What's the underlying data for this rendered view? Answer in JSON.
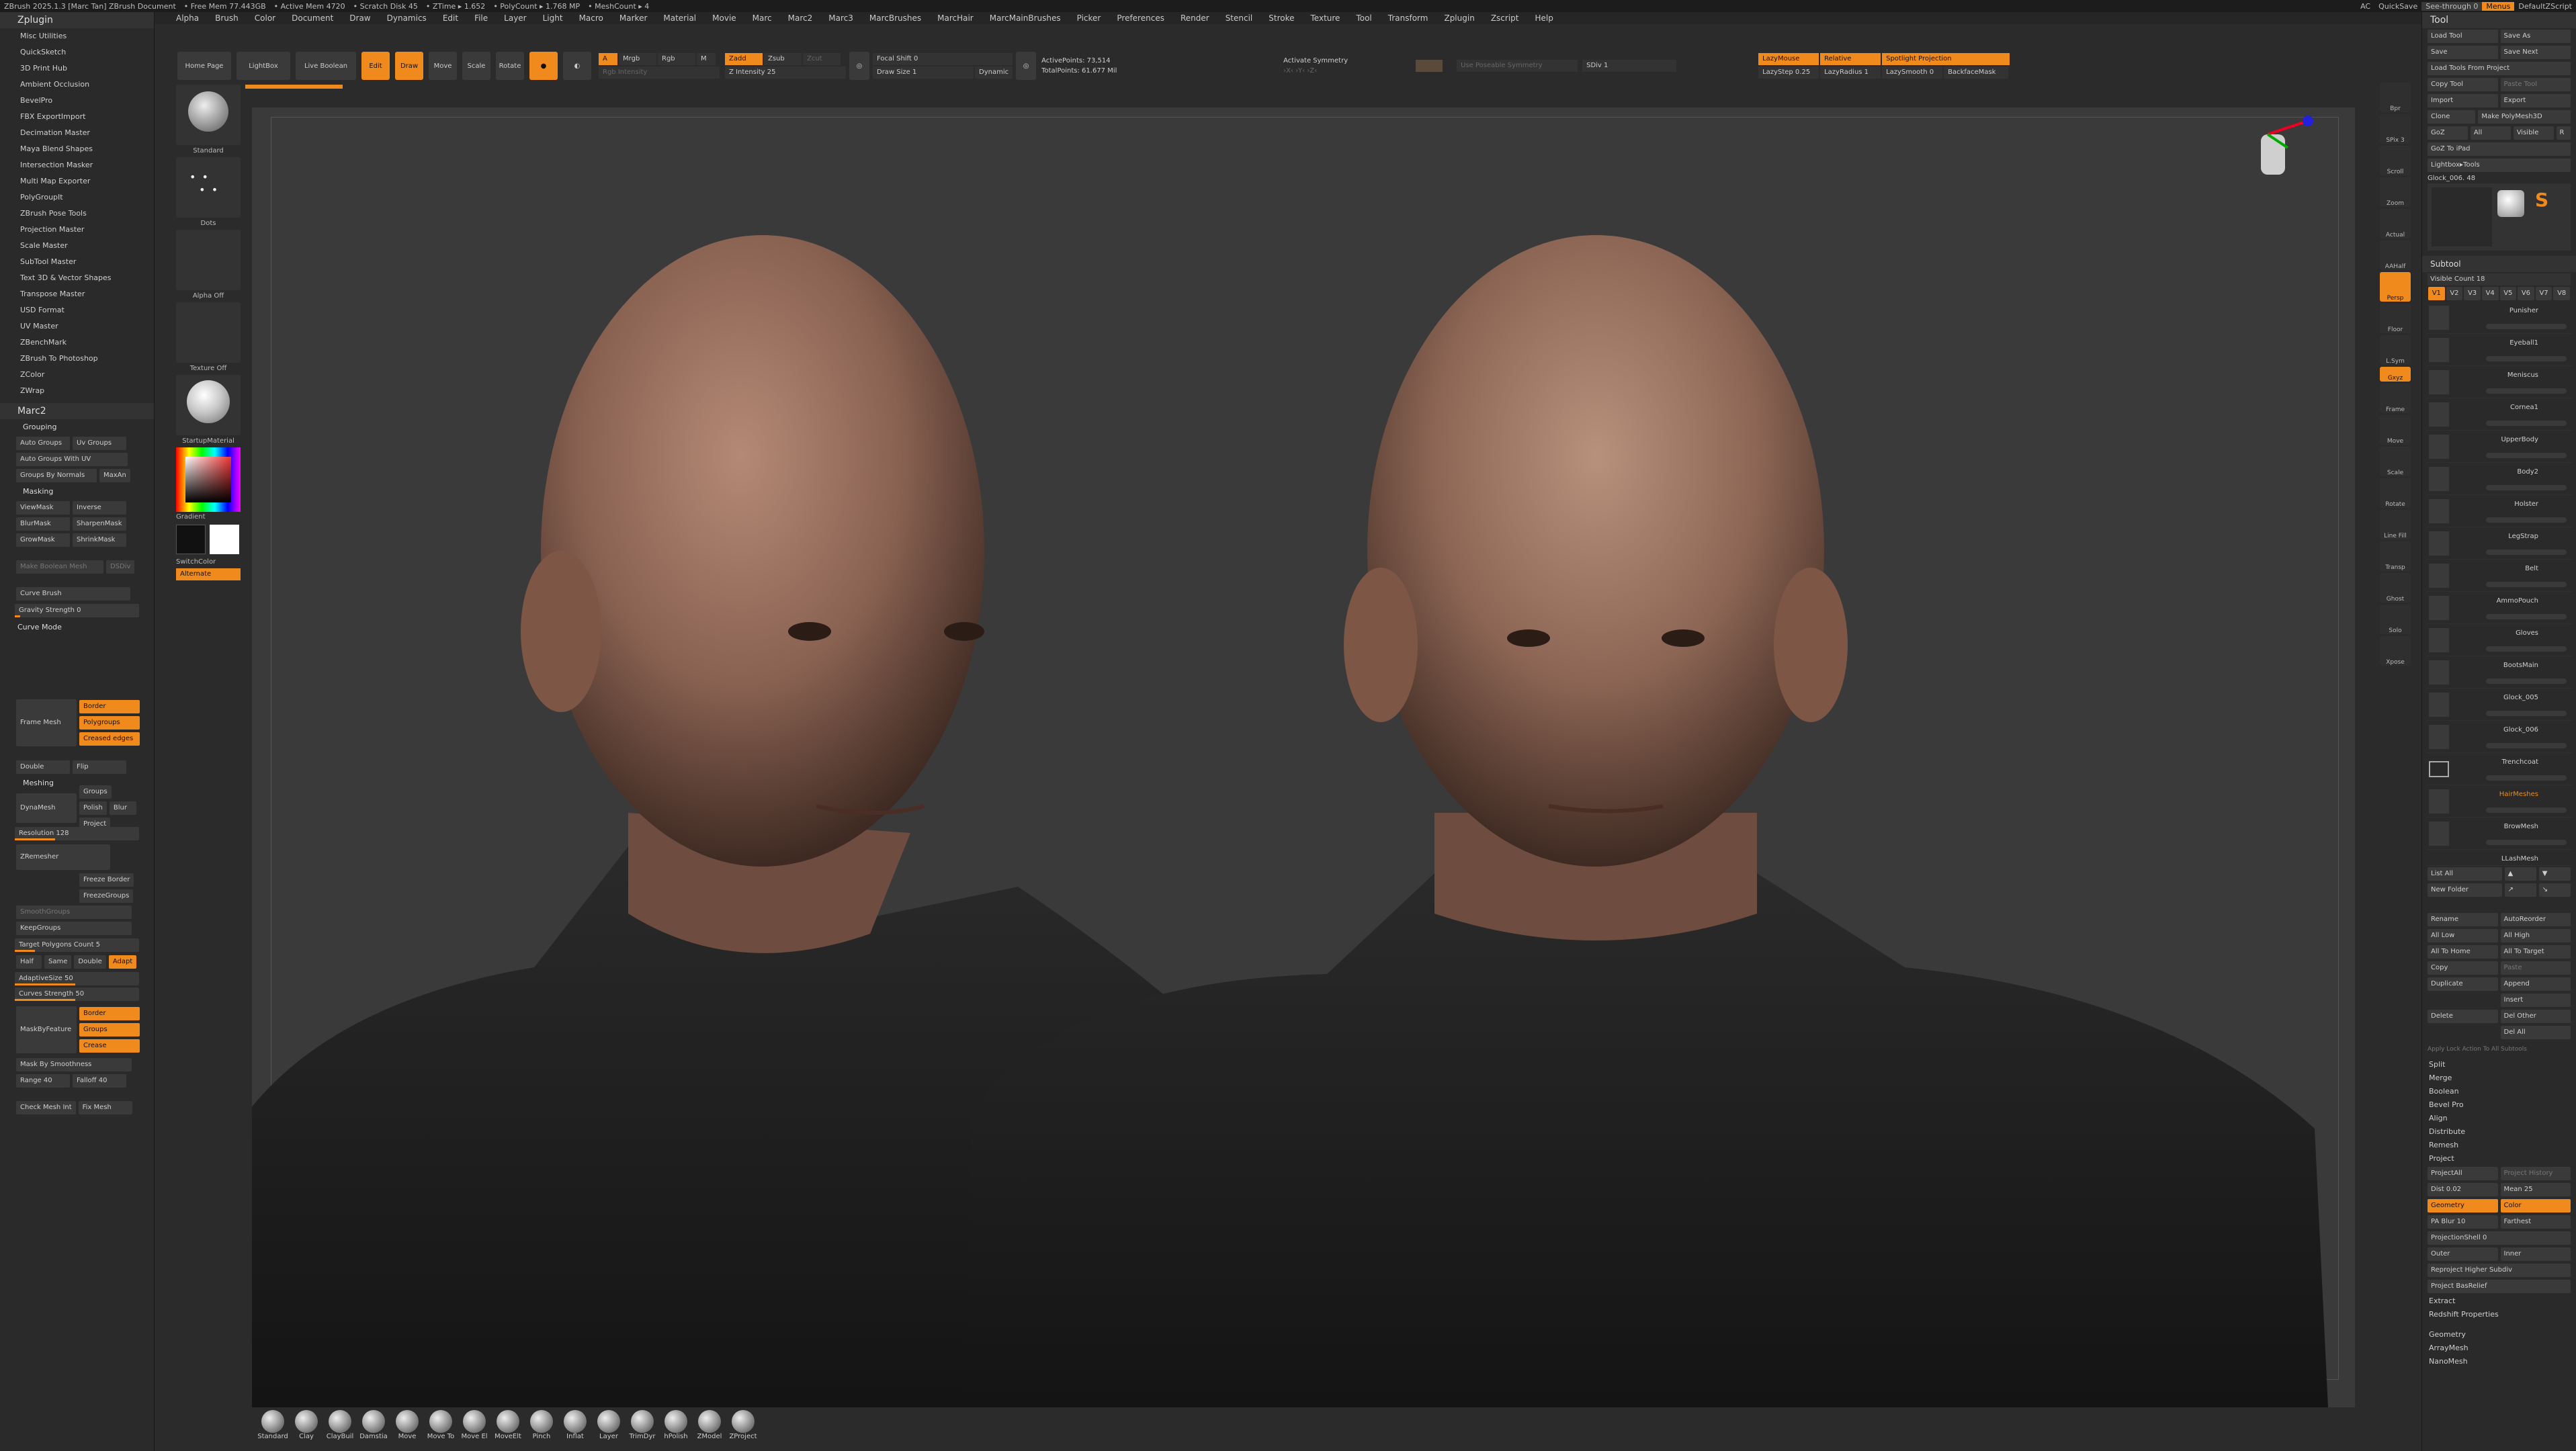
{
  "app": {
    "title": "ZBrush 2025.1.3 [Marc Tan]   ZBrush Document",
    "stats": [
      "• Free Mem 77.443GB",
      "• Active Mem 4720",
      "• Scratch Disk 45",
      "• ZTime ▸ 1.652",
      "• PolyCount ▸ 1.768 MP",
      "• MeshCount ▸ 4"
    ],
    "right_status": [
      "AC",
      "QuickSave",
      "See-through 0",
      "Menus",
      "DefaultZScript"
    ]
  },
  "menu": [
    "Alpha",
    "Brush",
    "Color",
    "Document",
    "Draw",
    "Dynamics",
    "Edit",
    "File",
    "Layer",
    "Light",
    "Macro",
    "Marker",
    "Material",
    "Movie",
    "Marc",
    "Marc2",
    "Marc3",
    "MarcBrushes",
    "MarcHair",
    "MarcMainBrushes",
    "Picker",
    "Preferences",
    "Render",
    "Stencil",
    "Stroke",
    "Texture",
    "Tool",
    "Transform",
    "Zplugin",
    "Zscript",
    "Help"
  ],
  "left_panel": {
    "title": "Zplugin",
    "plugins": [
      "Misc Utilities",
      "QuickSketch",
      "3D Print Hub",
      "Ambient Occlusion",
      "BevelPro",
      "FBX ExportImport",
      "Decimation Master",
      "Maya Blend Shapes",
      "Intersection Masker",
      "Multi Map Exporter",
      "PolyGroupIt",
      "ZBrush Pose Tools",
      "Projection Master",
      "Scale Master",
      "SubTool Master",
      "Text 3D & Vector Shapes",
      "Transpose Master",
      "USD Format",
      "UV Master",
      "ZBenchMark",
      "ZBrush To Photoshop",
      "ZColor",
      "ZWrap"
    ],
    "sub_title": "Marc2",
    "grouping_label": "Grouping",
    "grouping": [
      [
        "Auto Groups",
        "Uv Groups"
      ],
      [
        "Auto Groups With UV",
        ""
      ],
      [
        "Groups By Normals",
        "MaxAn"
      ]
    ],
    "masking_label": "Masking",
    "masking": [
      [
        "ViewMask",
        "Inverse"
      ],
      [
        "BlurMask",
        "SharpenMask"
      ],
      [
        "GrowMask",
        "ShrinkMask"
      ]
    ],
    "make_boolean": "Make Boolean Mesh",
    "dsdiv": "DSDiv",
    "curve_brush": "Curve Brush",
    "gravity": "Gravity Strength 0",
    "curve_mode": "Curve Mode",
    "frame_mesh": "Frame Mesh",
    "frame_opts": [
      "Border",
      "Polygroups",
      "Creased edges"
    ],
    "double": "Double",
    "flip": "Flip",
    "meshing": "Meshing",
    "dynamesh": "DynaMesh",
    "dyn_opts": [
      "Groups",
      "Polish",
      "Blur",
      "Project"
    ],
    "resolution": "Resolution 128",
    "zremesher": "ZRemesher",
    "freeze_border": "Freeze Border",
    "freeze_groups": "FreezeGroups",
    "smooth_groups": "SmoothGroups",
    "keep_groups": "KeepGroups",
    "target_poly": "Target Polygons Count 5",
    "half_row": [
      "Half",
      "Same",
      "Double",
      "Adapt"
    ],
    "adaptive": "AdaptiveSize 50",
    "curves_strength": "Curves Strength 50",
    "mask_by_feature": "MaskByFeature",
    "mbf_opts": [
      "Border",
      "Groups",
      "Crease"
    ],
    "mask_smooth": "Mask By Smoothness",
    "range": "Range 40",
    "falloff": "Falloff 40",
    "check_mesh": "Check Mesh Int",
    "fix_mesh": "Fix Mesh"
  },
  "shelf": {
    "brush_label": "Standard",
    "stroke_label": "Dots",
    "alpha_label": "Alpha Off",
    "texture_label": "Texture Off",
    "material_label": "StartupMaterial",
    "gradient_label": "Gradient",
    "switch_label": "SwitchColor",
    "alternate_label": "Alternate"
  },
  "top_tools": {
    "tabs": [
      "Home Page",
      "LightBox",
      "Live Boolean"
    ],
    "buttons": [
      "Edit",
      "Draw",
      "Move",
      "Scale",
      "Rotate"
    ],
    "mrgb": [
      "A",
      "Mrgb",
      "Rgb",
      "M"
    ],
    "zadd": "Zadd",
    "zsub": "Zsub",
    "zcut": "Zcut",
    "rgb_intensity": "Rgb Intensity",
    "z_intensity": "Z Intensity 25",
    "focal_shift": "Focal Shift 0",
    "draw_size": "Draw Size 1",
    "dynamic": "Dynamic",
    "active_points": "ActivePoints: 73,514",
    "total_points": "TotalPoints: 61.677 Mil",
    "symmetry": "Activate Symmetry",
    "use_poseable": "Use Poseable Symmetry",
    "sdiv": "SDiv 1",
    "lazymouse": "LazyMouse",
    "relative": "Relative",
    "spotlight": "Spotlight Projection",
    "lazystep": "LazyStep 0.25",
    "lazyradius": "LazyRadius 1",
    "lazysmooth": "LazySmooth 0",
    "backface": "BackfaceMask"
  },
  "right_dock": [
    "Bpr",
    "SPix 3",
    "Scroll",
    "Zoom",
    "Actual",
    "AAHalf",
    "Persp",
    "Floor",
    "L.Sym",
    "Move",
    "Frame",
    "Move",
    "Scale",
    "Rotate",
    "Line Fill",
    "Transp",
    "Ghost",
    "Solo",
    "Xpose"
  ],
  "right_panel": {
    "title": "Tool",
    "rows": [
      [
        "Load Tool",
        "Save As"
      ],
      [
        "Save",
        "Save Next"
      ],
      [
        "Load Tools From Project",
        ""
      ],
      [
        "Copy Tool",
        "Paste Tool"
      ],
      [
        "Import",
        "Export"
      ],
      [
        "Clone",
        "Make PolyMesh3D"
      ],
      [
        "GoZ",
        "All",
        "Visible",
        "R"
      ],
      [
        "GoZ To iPad",
        ""
      ],
      [
        "Lightbox▸Tools",
        ""
      ]
    ],
    "current_tool": "Glock_006. 48",
    "subtool_title": "Subtool",
    "visible_count": "Visible Count 18",
    "versions": [
      "V1",
      "V2",
      "V3",
      "V4",
      "V5",
      "V6",
      "V7",
      "V8"
    ],
    "subtools": [
      "Punisher",
      "Eyeball1",
      "Meniscus",
      "Cornea1",
      "UpperBody",
      "Body2",
      "Holster",
      "LegStrap",
      "Belt",
      "AmmoPouch",
      "Gloves",
      "BootsMain",
      "Glock_005",
      "Glock_006",
      "Trenchcoat",
      "HairMeshes",
      "BrowMesh",
      "LLashMesh"
    ],
    "list_all": "List All",
    "new_folder": "New Folder",
    "actions": [
      [
        "Rename",
        "AutoReorder"
      ],
      [
        "All Low",
        "All High"
      ],
      [
        "All To Home",
        "All To Target"
      ],
      [
        "Copy",
        "Paste"
      ],
      [
        "Duplicate",
        "Append"
      ],
      [
        "",
        "Insert"
      ],
      [
        "Delete",
        "Del Other"
      ],
      [
        "",
        "Del All"
      ]
    ],
    "apply_lock": "Apply Lock Action To All Subtools",
    "misc": [
      "Split",
      "Merge",
      "Boolean",
      "Bevel Pro",
      "Align",
      "Distribute",
      "Remesh"
    ],
    "project_label": "Project",
    "project_rows": [
      [
        "ProjectAll",
        "Project History"
      ],
      [
        "Dist 0.02",
        "Mean 25"
      ],
      [
        "Geometry",
        "Color"
      ],
      [
        "PA Blur 10",
        "Farthest"
      ],
      [
        "ProjectionShell 0",
        ""
      ],
      [
        "Outer",
        "Inner"
      ]
    ],
    "reproject": "Reproject Higher Subdiv",
    "project_basrelief": "Project BasRelief",
    "extract": "Extract",
    "redshift": "Redshift Properties",
    "footer": [
      "Geometry",
      "ArrayMesh",
      "NanoMesh"
    ]
  },
  "brushes": [
    "Standard",
    "Clay",
    "ClayBuil",
    "Damstia",
    "Move",
    "Move To",
    "Move El",
    "MoveElt",
    "Pinch",
    "Inflat",
    "Layer",
    "TrimDyr",
    "hPolish",
    "ZModel",
    "ZProject"
  ]
}
